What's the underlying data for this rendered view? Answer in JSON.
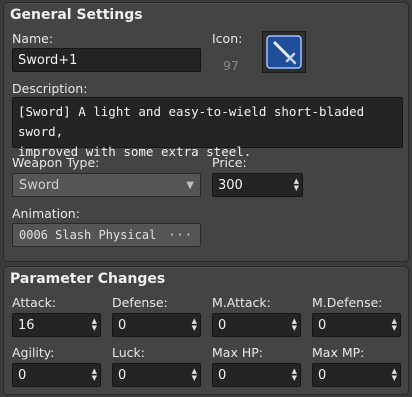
{
  "general": {
    "title": "General Settings",
    "name_label": "Name:",
    "name_value": "Sword+1",
    "icon_label": "Icon:",
    "icon_index": "97",
    "icon_name": "sword-icon",
    "description_label": "Description:",
    "description_value": "[Sword] A light and easy-to-wield short-bladed sword,\nimproved with some extra steel.",
    "weapon_type_label": "Weapon Type:",
    "weapon_type_value": "Sword",
    "price_label": "Price:",
    "price_value": "300",
    "animation_label": "Animation:",
    "animation_value": "0006 Slash Physical",
    "animation_button": "···"
  },
  "params": {
    "title": "Parameter Changes",
    "items": [
      {
        "label": "Attack:",
        "value": "16"
      },
      {
        "label": "Defense:",
        "value": "0"
      },
      {
        "label": "M.Attack:",
        "value": "0"
      },
      {
        "label": "M.Defense:",
        "value": "0"
      },
      {
        "label": "Agility:",
        "value": "0"
      },
      {
        "label": "Luck:",
        "value": "0"
      },
      {
        "label": "Max HP:",
        "value": "0"
      },
      {
        "label": "Max MP:",
        "value": "0"
      }
    ]
  },
  "colors": {
    "panel": "#444444",
    "field": "#242424",
    "icon_bg": "#1f4f9a"
  }
}
